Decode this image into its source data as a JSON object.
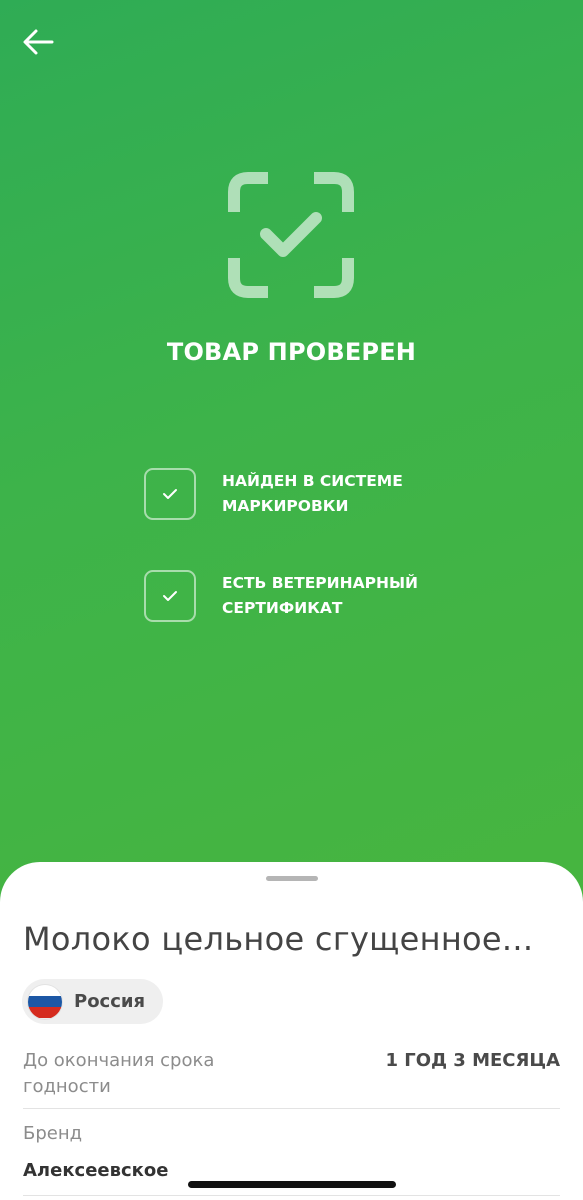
{
  "header": {
    "back_icon": "arrow-left-icon"
  },
  "status": {
    "icon": "scan-check-icon",
    "title": "ТОВАР ПРОВЕРЕН",
    "checks": [
      {
        "icon": "checkmark-icon",
        "line1": "НАЙДЕН В СИСТЕМЕ",
        "line2": "МАРКИРОВКИ"
      },
      {
        "icon": "checkmark-icon",
        "line1": "ЕСТЬ ВЕТЕРИНАРНЫЙ",
        "line2": "СЕРТИФИКАТ"
      }
    ]
  },
  "product": {
    "name": "Молоко цельное сгущенное...",
    "country": {
      "label": "Россия",
      "flag_icon": "russia-flag-icon"
    },
    "expiry": {
      "label_line1": "До окончания срока",
      "label_line2": "годности",
      "value": "1 ГОД 3 МЕСЯЦА"
    },
    "brand": {
      "label": "Бренд",
      "value": "Алексеевское"
    }
  },
  "colors": {
    "hero_green_start": "#2fac55",
    "hero_green_end": "#47b53f",
    "flag_white": "#ffffff",
    "flag_blue": "#1c57a5",
    "flag_red": "#d52b1e"
  }
}
